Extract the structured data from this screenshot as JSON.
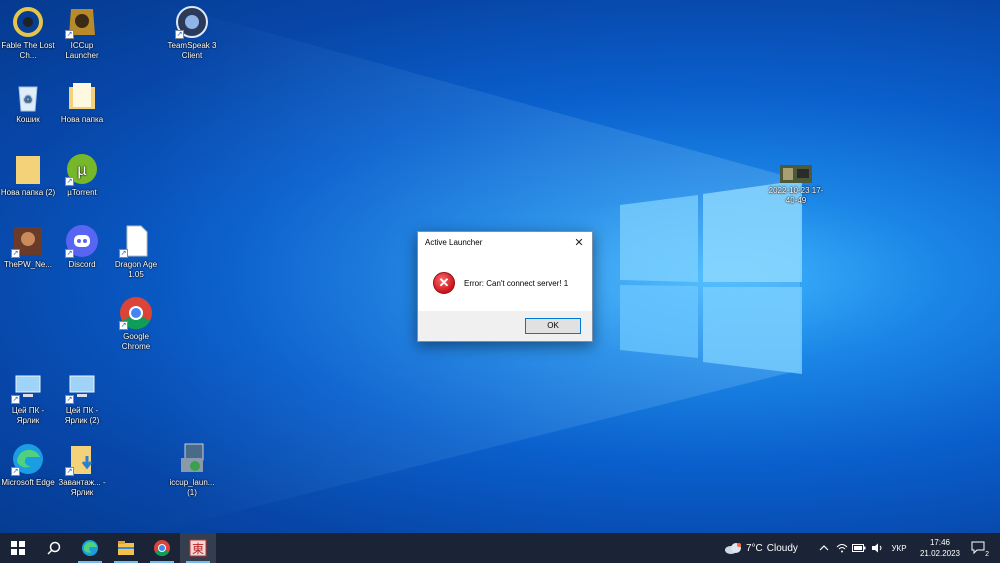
{
  "desktop": {
    "icons": [
      {
        "label": "Fable The Lost Ch...",
        "icon": "fable-game-icon"
      },
      {
        "label": "ICCup Launcher",
        "icon": "iccup-icon"
      },
      {
        "label": "TeamSpeak 3 Client",
        "icon": "teamspeak-icon"
      },
      {
        "label": "Кошик",
        "icon": "recycle-bin-icon"
      },
      {
        "label": "Нова папка",
        "icon": "folder-icon"
      },
      {
        "label": "Нова папка (2)",
        "icon": "folder-icon"
      },
      {
        "label": "µTorrent",
        "icon": "utorrent-icon"
      },
      {
        "label": "ThePW_Ne...",
        "icon": "game-icon"
      },
      {
        "label": "Discord",
        "icon": "discord-icon"
      },
      {
        "label": "Dragon Age 1.05",
        "icon": "document-icon"
      },
      {
        "label": "Google Chrome",
        "icon": "chrome-icon"
      },
      {
        "label": "Цей ПК - Ярлик",
        "icon": "computer-icon"
      },
      {
        "label": "Цей ПК - Ярлик (2)",
        "icon": "computer-icon"
      },
      {
        "label": "Microsoft Edge",
        "icon": "edge-icon"
      },
      {
        "label": "Завантаж... - Ярлик",
        "icon": "downloads-folder-icon"
      },
      {
        "label": "iccup_laun... (1)",
        "icon": "installer-icon"
      },
      {
        "label": "2022-10-23 17-40-49",
        "icon": "image-thumbnail-icon"
      }
    ]
  },
  "dialog": {
    "title": "Active Launcher",
    "close": "✕",
    "message": "Error: Can't connect server! 1",
    "ok_label": "OK",
    "error_icon": "error-icon"
  },
  "taskbar": {
    "apps": [
      {
        "name": "start",
        "icon": "windows-start-icon"
      },
      {
        "name": "search",
        "icon": "search-icon"
      },
      {
        "name": "edge",
        "icon": "edge-icon"
      },
      {
        "name": "file-explorer",
        "icon": "folder-icon"
      },
      {
        "name": "chrome",
        "icon": "chrome-icon"
      },
      {
        "name": "active-launcher",
        "icon": "launcher-icon"
      }
    ],
    "weather": {
      "temp": "7°C",
      "condition": "Cloudy"
    },
    "language": "УКР",
    "time": "17:46",
    "date": "21.02.2023",
    "notifications": "2",
    "tray_colors": {
      "bar": "#1a2436",
      "accent": "#76b9ed"
    }
  }
}
